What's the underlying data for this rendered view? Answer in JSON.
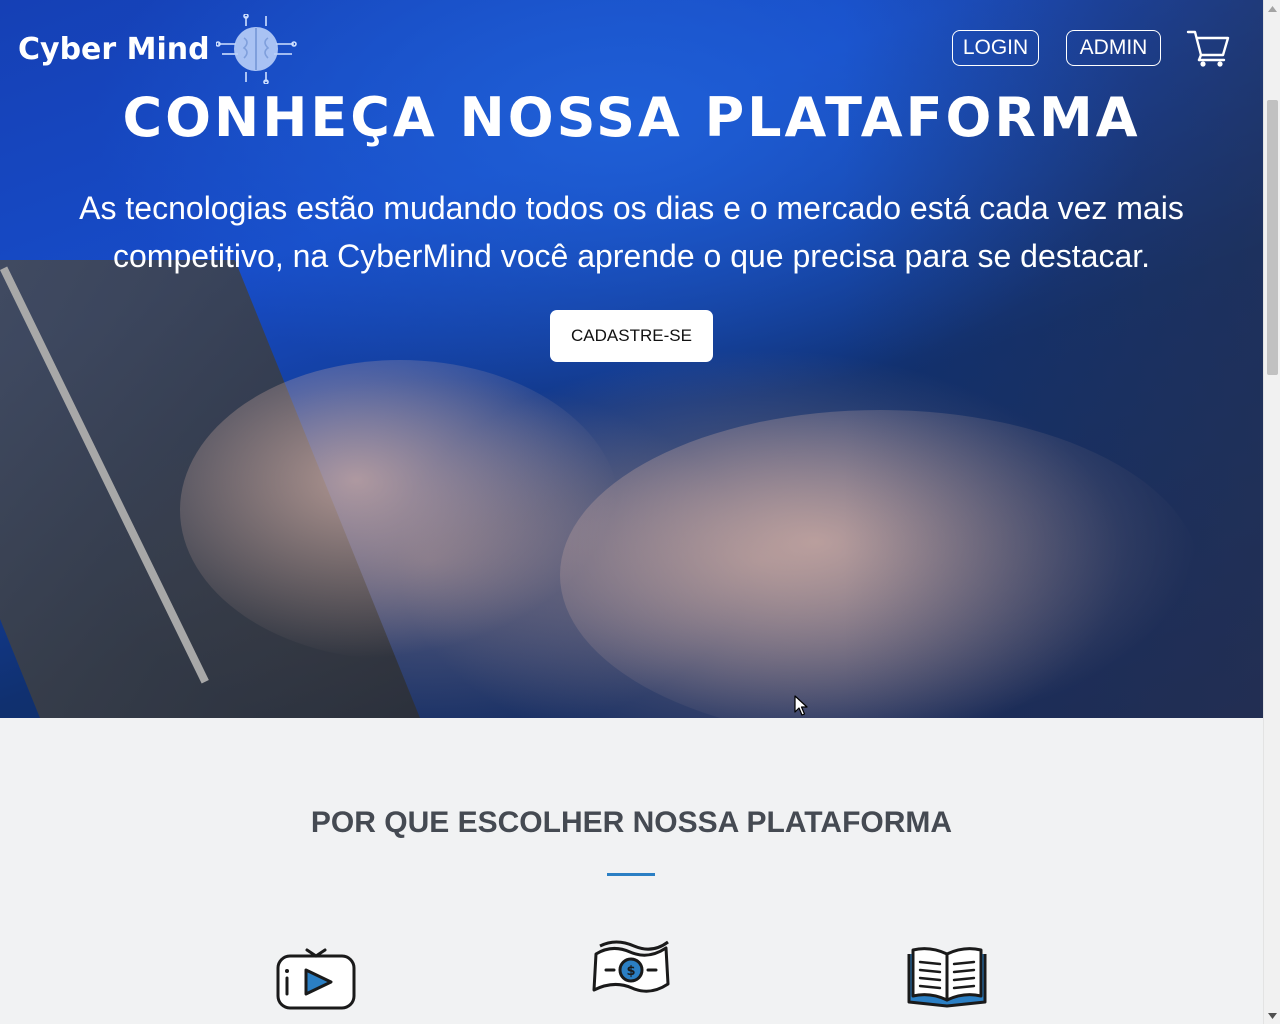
{
  "brand": {
    "name": "Cyber Mind",
    "logo_icon": "brain-circuit-icon"
  },
  "nav": {
    "login_label": "LOGIN",
    "admin_label": "ADMIN",
    "cart_icon": "cart-icon"
  },
  "hero": {
    "title": "CONHEÇA NOSSA PLATAFORMA",
    "subtitle_line1": "As tecnologias estão mudando todos os dias e o mercado está cada vez mais",
    "subtitle_line2": "competitivo, na CyberMind você aprende o que precisa para se destacar.",
    "cta_label": "CADASTRE-SE"
  },
  "features": {
    "title": "POR QUE ESCOLHER NOSSA PLATAFORMA",
    "items": [
      {
        "icon": "video-play-icon"
      },
      {
        "icon": "money-bill-icon"
      },
      {
        "icon": "open-book-icon"
      }
    ]
  },
  "colors": {
    "accent": "#2b7fc4",
    "section_title": "#454a52",
    "section_bg": "#f1f2f3"
  }
}
